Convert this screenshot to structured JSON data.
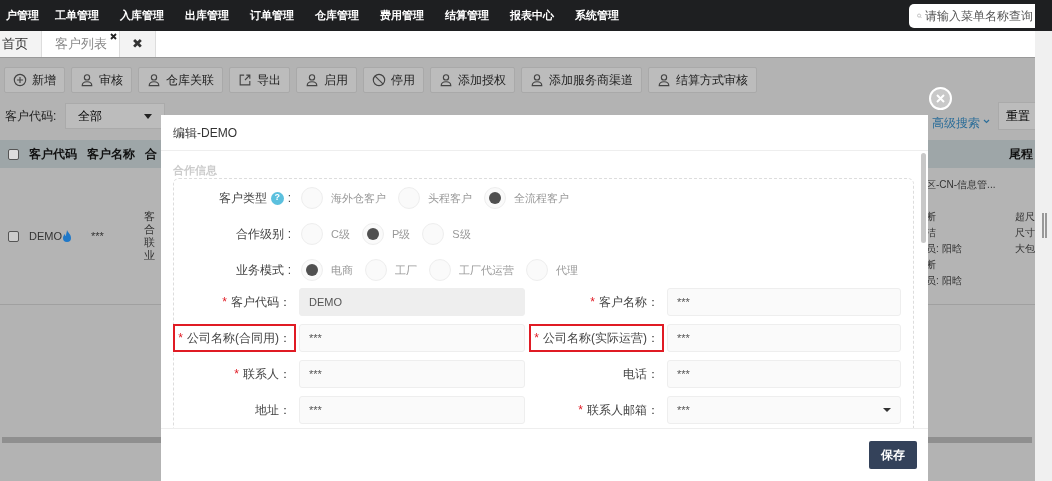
{
  "nav": {
    "items": [
      "户管理",
      "工单管理",
      "入库管理",
      "出库管理",
      "订单管理",
      "仓库管理",
      "费用管理",
      "结算管理",
      "报表中心",
      "系统管理"
    ],
    "search": {
      "placeholder": "请输入菜单名称查询"
    }
  },
  "tabs": [
    {
      "label": "首页",
      "selected": false,
      "closable": false
    },
    {
      "label": "客户列表",
      "selected": true,
      "closable": true
    },
    {
      "label": "✖",
      "selected": false,
      "closable": false
    }
  ],
  "toolbar": [
    {
      "label": "新增",
      "kind": "plus"
    },
    {
      "label": "审核",
      "kind": "user"
    },
    {
      "label": "仓库关联",
      "kind": "user"
    },
    {
      "label": "导出",
      "kind": "export"
    },
    {
      "label": "启用",
      "kind": "user"
    },
    {
      "label": "停用",
      "kind": "ban"
    },
    {
      "label": "添加授权",
      "kind": "user"
    },
    {
      "label": "添加服务商渠道",
      "kind": "user"
    },
    {
      "label": "结算方式审核",
      "kind": "user"
    }
  ],
  "filter": {
    "label": "客户代码:",
    "value": "全部",
    "advanced": "高级搜索",
    "reset": "重置"
  },
  "table": {
    "header_checked": false,
    "columns": [
      "客户代码",
      "客户名称",
      "合"
    ],
    "right_column": "尾程",
    "row": {
      "checked": false,
      "code": "DEMO",
      "name": "***",
      "column_3": [
        "客",
        "合",
        "联",
        "业"
      ],
      "right_top": "区-CN-信息管...",
      "right_lines": [
        "断",
        "洁",
        "员: 阳晗",
        "断",
        "员: 阳晗"
      ],
      "last": [
        "超尺",
        "尺寸",
        "大包"
      ]
    }
  },
  "modal": {
    "title": "编辑-DEMO",
    "section": "合作信息",
    "radio_rows": [
      {
        "label": "客户类型",
        "help": "?",
        "colon": ":",
        "options": [
          {
            "label": "海外仓客户",
            "selected": false
          },
          {
            "label": "头程客户",
            "selected": false
          },
          {
            "label": "全流程客户",
            "selected": true
          }
        ]
      },
      {
        "label": "合作级别",
        "colon": ":",
        "options": [
          {
            "label": "C级",
            "selected": false
          },
          {
            "label": "P级",
            "selected": true
          },
          {
            "label": "S级",
            "selected": false
          }
        ]
      },
      {
        "label": "业务模式",
        "colon": ":",
        "options": [
          {
            "label": "电商",
            "selected": true
          },
          {
            "label": "工厂",
            "selected": false
          },
          {
            "label": "工厂代运营",
            "selected": false
          },
          {
            "label": "代理",
            "selected": false
          }
        ]
      }
    ],
    "fields": [
      {
        "label": "客户代码：",
        "required": "*",
        "value": "DEMO",
        "kind": "readonly",
        "highlighted": false
      },
      {
        "label": "客户名称：",
        "required": "*",
        "value": "***",
        "kind": "text",
        "highlighted": false
      },
      {
        "label": "公司名称(合同用)：",
        "required": "*",
        "value": "***",
        "kind": "text",
        "highlighted": true
      },
      {
        "label": "公司名称(实际运营)：",
        "required": "*",
        "value": "***",
        "kind": "text",
        "highlighted": true
      },
      {
        "label": "联系人：",
        "required": "*",
        "value": "***",
        "kind": "text",
        "highlighted": false
      },
      {
        "label": "电话：",
        "value": "***",
        "kind": "text",
        "highlighted": false
      },
      {
        "label": "地址：",
        "value": "***",
        "kind": "text",
        "highlighted": false
      },
      {
        "label": "联系人邮箱：",
        "required": "*",
        "value": "***",
        "kind": "select",
        "highlighted": false
      }
    ],
    "save": "保存"
  }
}
